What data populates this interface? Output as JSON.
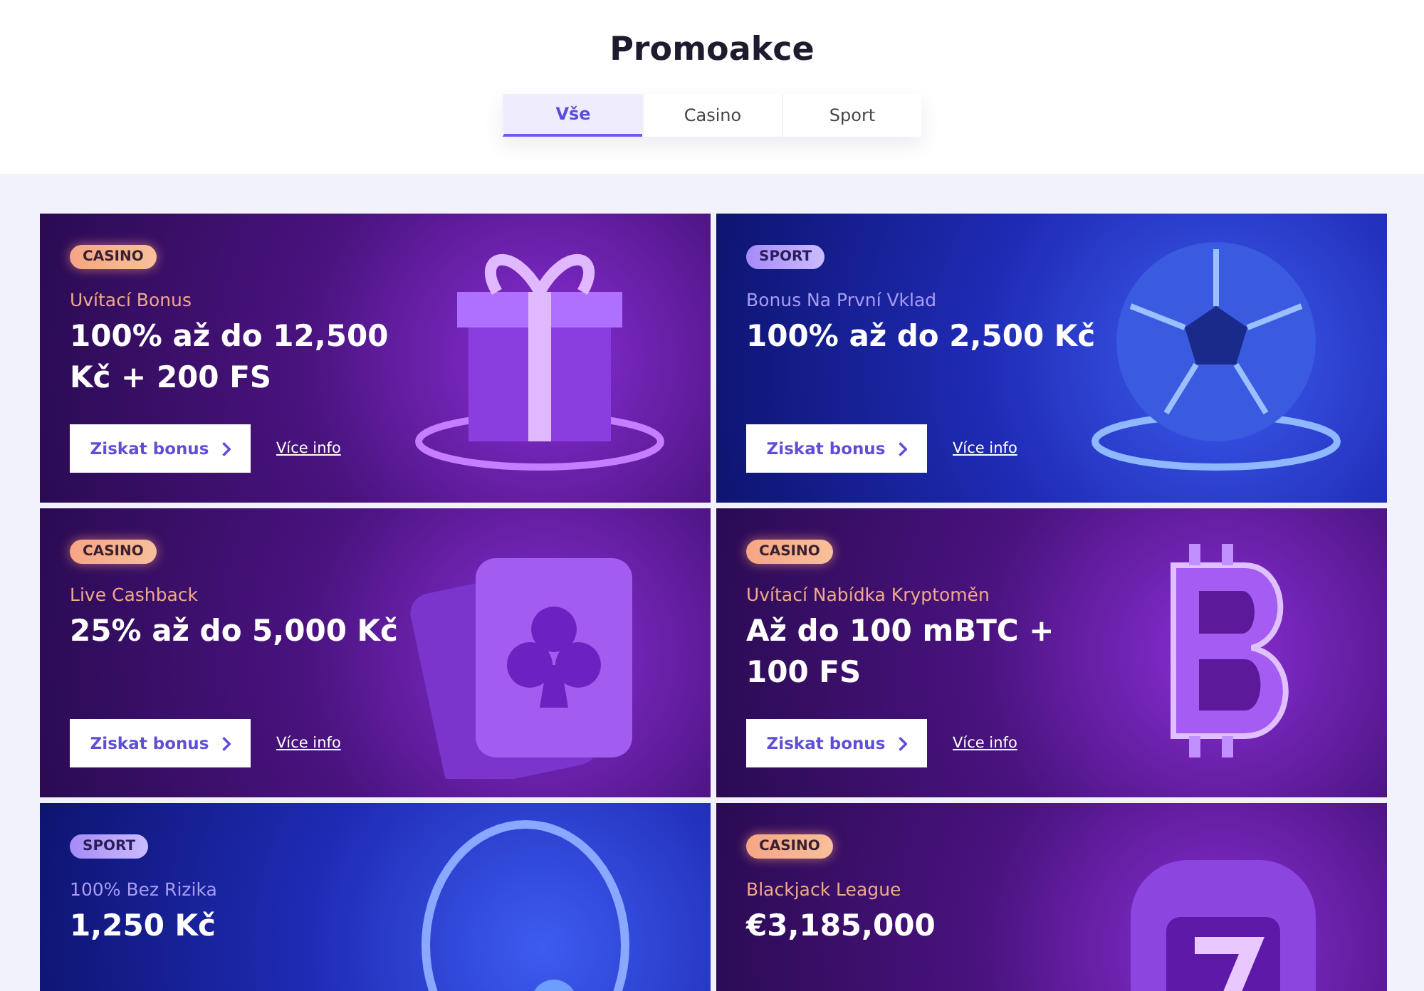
{
  "page_title": "Promoakce",
  "tabs": [
    {
      "label": "Vše",
      "selected": true
    },
    {
      "label": "Casino",
      "selected": false
    },
    {
      "label": "Sport",
      "selected": false
    }
  ],
  "promotions": [
    {
      "kind": "casino",
      "tag": "CASINO",
      "subtitle": "Uvítací Bonus",
      "headline": "100% až do 12,500 Kč + 200 FS",
      "button": "Ziskat bonus",
      "link": "Více info"
    },
    {
      "kind": "sport",
      "tag": "SPORT",
      "subtitle": "Bonus Na První Vklad",
      "headline": "100% až do 2,500 Kč",
      "button": "Ziskat bonus",
      "link": "Více info"
    },
    {
      "kind": "casino",
      "tag": "CASINO",
      "subtitle": "Live Cashback",
      "headline": "25% až do 5,000 Kč",
      "button": "Ziskat bonus",
      "link": "Více info"
    },
    {
      "kind": "casino",
      "tag": "CASINO",
      "subtitle": "Uvítací Nabídka Kryptoměn",
      "headline": "Až do 100 mBTC + 100 FS",
      "button": "Ziskat bonus",
      "link": "Více info"
    },
    {
      "kind": "sport",
      "tag": "SPORT",
      "subtitle": "100% Bez Rizika",
      "headline": "1,250 Kč"
    },
    {
      "kind": "casino",
      "tag": "CASINO",
      "subtitle": "Blackjack League",
      "headline": "€3,185,000"
    }
  ]
}
